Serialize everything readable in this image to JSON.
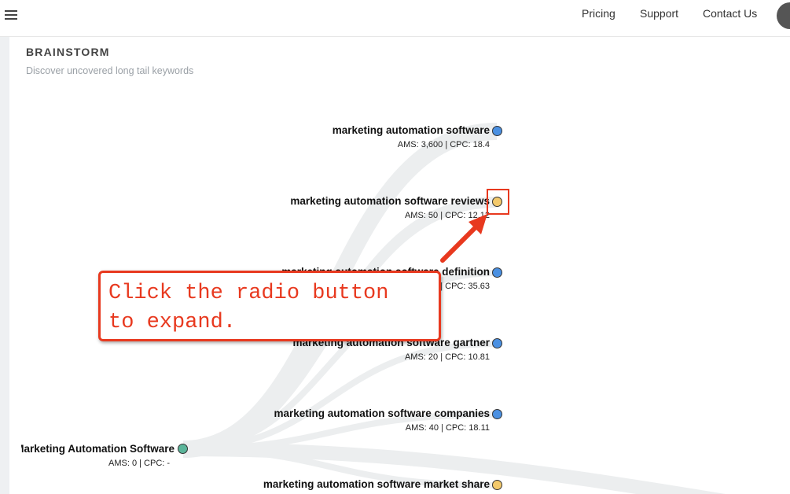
{
  "header": {
    "nav": [
      {
        "label": "Pricing"
      },
      {
        "label": "Support"
      },
      {
        "label": "Contact Us"
      }
    ]
  },
  "section": {
    "title": "BRAINSTORM",
    "subtitle": "Discover uncovered long tail keywords"
  },
  "root": {
    "label": "Marketing Automation Software",
    "stats": "AMS: 0 | CPC: -",
    "dot_color": "#5bb59a"
  },
  "children": [
    {
      "label": "marketing automation software",
      "stats": "AMS: 3,600 | CPC: 18.4",
      "dot_color": "#4a90e2"
    },
    {
      "label": "marketing automation software reviews",
      "stats": "AMS: 50 | CPC: 12.12",
      "dot_color": "#f3c96b"
    },
    {
      "label": "marketing automation software definition",
      "stats": "AMS: 10 | CPC: 35.63",
      "dot_color": "#4a90e2"
    },
    {
      "label": "marketing automation software gartner",
      "stats": "AMS: 20 | CPC: 10.81",
      "dot_color": "#4a90e2"
    },
    {
      "label": "marketing automation software companies",
      "stats": "AMS: 40 | CPC: 18.11",
      "dot_color": "#4a90e2"
    },
    {
      "label": "marketing automation software market share",
      "stats": "",
      "dot_color": "#f3c96b"
    }
  ],
  "annotation": {
    "line1": "Click the radio button",
    "line2": "to expand.",
    "color": "#e8391f"
  }
}
